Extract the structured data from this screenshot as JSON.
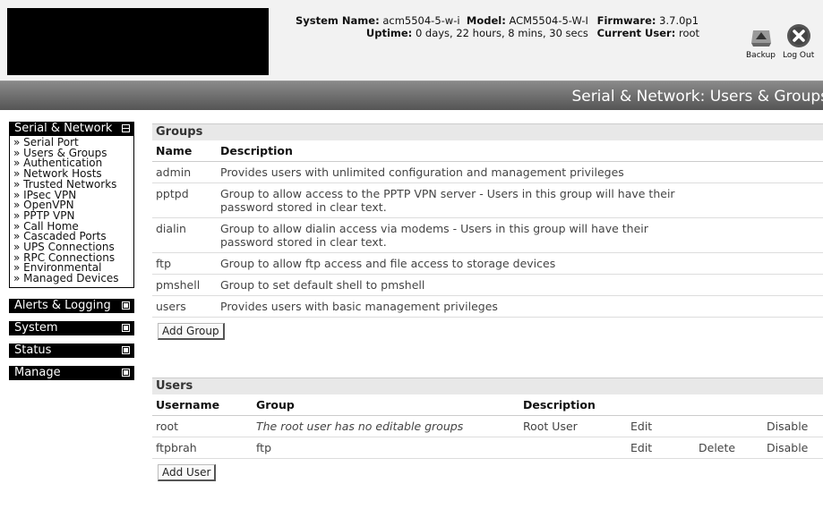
{
  "header": {
    "sysinfo": {
      "system_name_label": "System Name:",
      "system_name": "acm5504-5-w-i",
      "model_label": "Model:",
      "model": "ACM5504-5-W-I",
      "uptime_label": "Uptime:",
      "uptime": "0 days, 22 hours, 8 mins, 30 secs",
      "firmware_label": "Firmware:",
      "firmware": "3.7.0p1",
      "current_user_label": "Current User:",
      "current_user": "root"
    },
    "backup_label": "Backup",
    "logout_label": "Log Out"
  },
  "page_title": "Serial & Network: Users & Groups",
  "nav": {
    "serial_network": {
      "label": "Serial & Network",
      "items": [
        "» Serial Port",
        "» Users & Groups",
        "» Authentication",
        "» Network Hosts",
        "» Trusted Networks",
        "» IPsec VPN",
        "» OpenVPN",
        "» PPTP VPN",
        "» Call Home",
        "» Cascaded Ports",
        "» UPS Connections",
        "» RPC Connections",
        "» Environmental",
        "» Managed Devices"
      ]
    },
    "alerts": {
      "label": "Alerts & Logging"
    },
    "system": {
      "label": "System"
    },
    "status": {
      "label": "Status"
    },
    "manage": {
      "label": "Manage"
    }
  },
  "groups": {
    "title": "Groups",
    "headers": {
      "name": "Name",
      "description": "Description"
    },
    "rows": [
      {
        "name": "admin",
        "description": "Provides users with unlimited configuration and management privileges"
      },
      {
        "name": "pptpd",
        "description": "Group to allow access to the PPTP VPN server - Users in this group will have their password stored in clear text."
      },
      {
        "name": "dialin",
        "description": "Group to allow dialin access via modems - Users in this group will have their password stored in clear text."
      },
      {
        "name": "ftp",
        "description": "Group to allow ftp access and file access to storage devices"
      },
      {
        "name": "pmshell",
        "description": "Group to set default shell to pmshell"
      },
      {
        "name": "users",
        "description": "Provides users with basic management privileges"
      }
    ],
    "add_label": "Add Group"
  },
  "users": {
    "title": "Users",
    "headers": {
      "username": "Username",
      "group": "Group",
      "description": "Description"
    },
    "rows": [
      {
        "username": "root",
        "group": "The root user has no editable groups",
        "description": "Root User",
        "edit": "Edit",
        "delete": "",
        "disable": "Disable"
      },
      {
        "username": "ftpbrah",
        "group": "ftp",
        "description": "",
        "edit": "Edit",
        "delete": "Delete",
        "disable": "Disable"
      }
    ],
    "add_label": "Add User"
  },
  "colors": {
    "title_bar": "#6e6e6e",
    "nav_header": "#000000",
    "table_title_bg": "#e8e8e8"
  }
}
